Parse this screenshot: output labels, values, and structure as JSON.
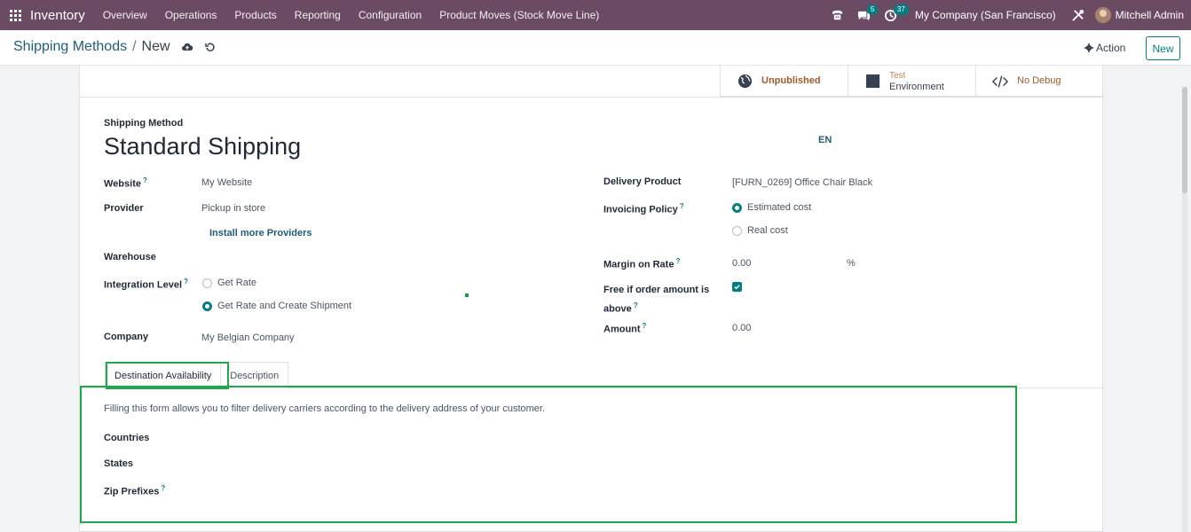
{
  "navbar": {
    "app_name": "Inventory",
    "menu": [
      "Overview",
      "Operations",
      "Products",
      "Reporting",
      "Configuration",
      "Product Moves (Stock Move Line)"
    ],
    "messages_count": "5",
    "activities_count": "37",
    "company": "My Company (San Francisco)",
    "user": "Mitchell Admin",
    "background_color": "#6b4a64"
  },
  "control_panel": {
    "breadcrumb_parent": "Shipping Methods",
    "breadcrumb_separator": "/",
    "breadcrumb_current": "New",
    "action_label": "Action",
    "new_label": "New"
  },
  "smart_buttons": {
    "website": "Unpublished",
    "environment_top": "Test",
    "environment_bottom": "Environment",
    "debug": "No Debug"
  },
  "form": {
    "name_label": "Shipping Method",
    "name": "Standard Shipping",
    "language": "EN",
    "website_label": "Website",
    "website": "My Website",
    "provider_label": "Provider",
    "provider": "Pickup in store",
    "install_providers": "Install more Providers",
    "warehouse_label": "Warehouse",
    "integration_label": "Integration Level",
    "integration_options": [
      "Get Rate",
      "Get Rate and Create Shipment"
    ],
    "company_label": "Company",
    "company": "My Belgian Company",
    "delivery_product_label": "Delivery Product",
    "delivery_product": "[FURN_0269] Office Chair Black",
    "invoicing_label": "Invoicing Policy",
    "invoicing_options": [
      "Estimated cost",
      "Real cost"
    ],
    "margin_label": "Margin on Rate",
    "margin": "0.00",
    "margin_unit": "%",
    "free_label_1": "Free if order amount is",
    "free_label_2": "above",
    "amount_label": "Amount",
    "amount": "0.00",
    "tooltip_mark": "?"
  },
  "tabs": [
    "Destination Availability",
    "Description"
  ],
  "destination": {
    "hint": "Filling this form allows you to filter delivery carriers according to the delivery address of your customer.",
    "countries_label": "Countries",
    "states_label": "States",
    "zip_label": "Zip Prefixes"
  },
  "colors": {
    "accent": "#017e84",
    "highlight_outline": "#1ea84a"
  }
}
